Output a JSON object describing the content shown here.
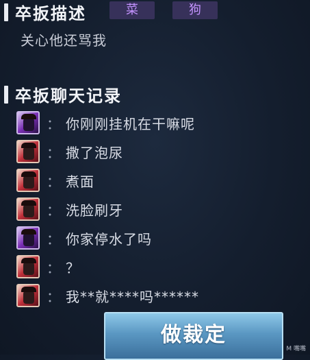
{
  "description": {
    "title": "卒扳描述",
    "tags": [
      "菜",
      "狗"
    ],
    "text": "关心他还骂我"
  },
  "chat": {
    "title": "卒扳聊天记录",
    "separator": "：",
    "messages": [
      {
        "avatar": "purple",
        "text": "你刚刚挂机在干嘛呢"
      },
      {
        "avatar": "red",
        "text": "撒了泡尿"
      },
      {
        "avatar": "red",
        "text": "煮面"
      },
      {
        "avatar": "red",
        "text": "洗脸刷牙"
      },
      {
        "avatar": "purple",
        "text": "你家停水了吗"
      },
      {
        "avatar": "red",
        "text": "？"
      },
      {
        "avatar": "red",
        "text": "我**就****吗******"
      }
    ]
  },
  "decide_button": {
    "label": "做裁定"
  },
  "watermark": "M 嘴嘴"
}
